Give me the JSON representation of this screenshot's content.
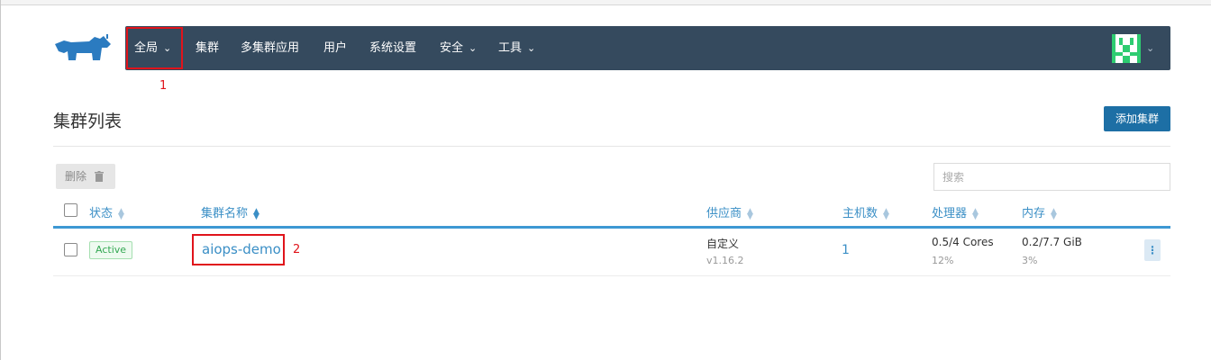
{
  "nav": {
    "items": [
      {
        "label": "全局",
        "dropdown": true
      },
      {
        "label": "集群",
        "dropdown": false
      },
      {
        "label": "多集群应用",
        "dropdown": false
      },
      {
        "label": "用户",
        "dropdown": false
      },
      {
        "label": "系统设置",
        "dropdown": false
      },
      {
        "label": "安全",
        "dropdown": true
      },
      {
        "label": "工具",
        "dropdown": true
      }
    ],
    "background_color": "#354a5e"
  },
  "annotations": {
    "global_marker": "1",
    "cluster_marker": "2"
  },
  "page": {
    "title": "集群列表",
    "add_button": "添加集群",
    "delete_button": "删除",
    "search_placeholder": "搜索"
  },
  "table": {
    "headers": {
      "state": "状态",
      "name": "集群名称",
      "provider": "供应商",
      "nodes": "主机数",
      "cpu": "处理器",
      "memory": "内存"
    },
    "rows": [
      {
        "state": "Active",
        "name": "aiops-demo",
        "provider": "自定义",
        "version": "v1.16.2",
        "nodes": "1",
        "cpu": "0.5/4 Cores",
        "cpu_pct": "12%",
        "memory": "0.2/7.7 GiB",
        "memory_pct": "3%"
      }
    ]
  },
  "colors": {
    "accent": "#3b8fc6",
    "primary_button": "#1d6fa5",
    "highlight": "#e0141b",
    "active": "#34a853"
  }
}
